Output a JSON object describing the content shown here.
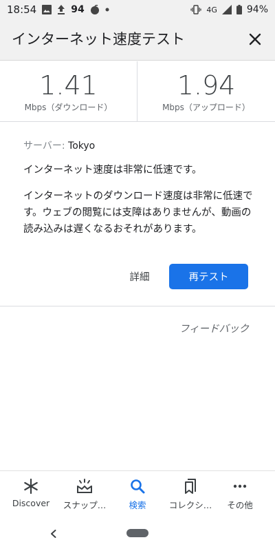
{
  "status_bar": {
    "time": "18:54",
    "notification_count": "94",
    "network": "4G",
    "battery": "94%",
    "icons": [
      "image-icon",
      "upload-icon",
      "app-notification-icon",
      "dot-icon",
      "vibrate-icon",
      "signal-icon",
      "battery-icon"
    ]
  },
  "header": {
    "title": "インターネット速度テスト",
    "close_icon": "close-icon"
  },
  "results": {
    "download": {
      "value": "1.41",
      "unit": "Mbps（ダウンロード）"
    },
    "upload": {
      "value": "1.94",
      "unit": "Mbps（アップロード）"
    }
  },
  "card": {
    "server_label": "サーバー:",
    "server_value": "Tokyo",
    "headline": "インターネット速度は非常に低速です。",
    "description": "インターネットのダウンロード速度は非常に低速です。ウェブの閲覧には支障はありませんが、動画の読み込みは遅くなるおそれがあります。",
    "detail_label": "詳細",
    "retest_label": "再テスト"
  },
  "feedback_label": "フィードバック",
  "bottom_nav": {
    "items": [
      {
        "label": "Discover",
        "icon": "asterisk-icon"
      },
      {
        "label": "スナップ…",
        "icon": "snapshot-icon"
      },
      {
        "label": "検索",
        "icon": "search-icon",
        "active": true
      },
      {
        "label": "コレクシ…",
        "icon": "collections-icon"
      },
      {
        "label": "その他",
        "icon": "more-icon"
      }
    ]
  },
  "colors": {
    "accent": "#1a73e8",
    "text": "#202124",
    "muted": "#5f6368",
    "header_bg": "#f1f1f1"
  }
}
